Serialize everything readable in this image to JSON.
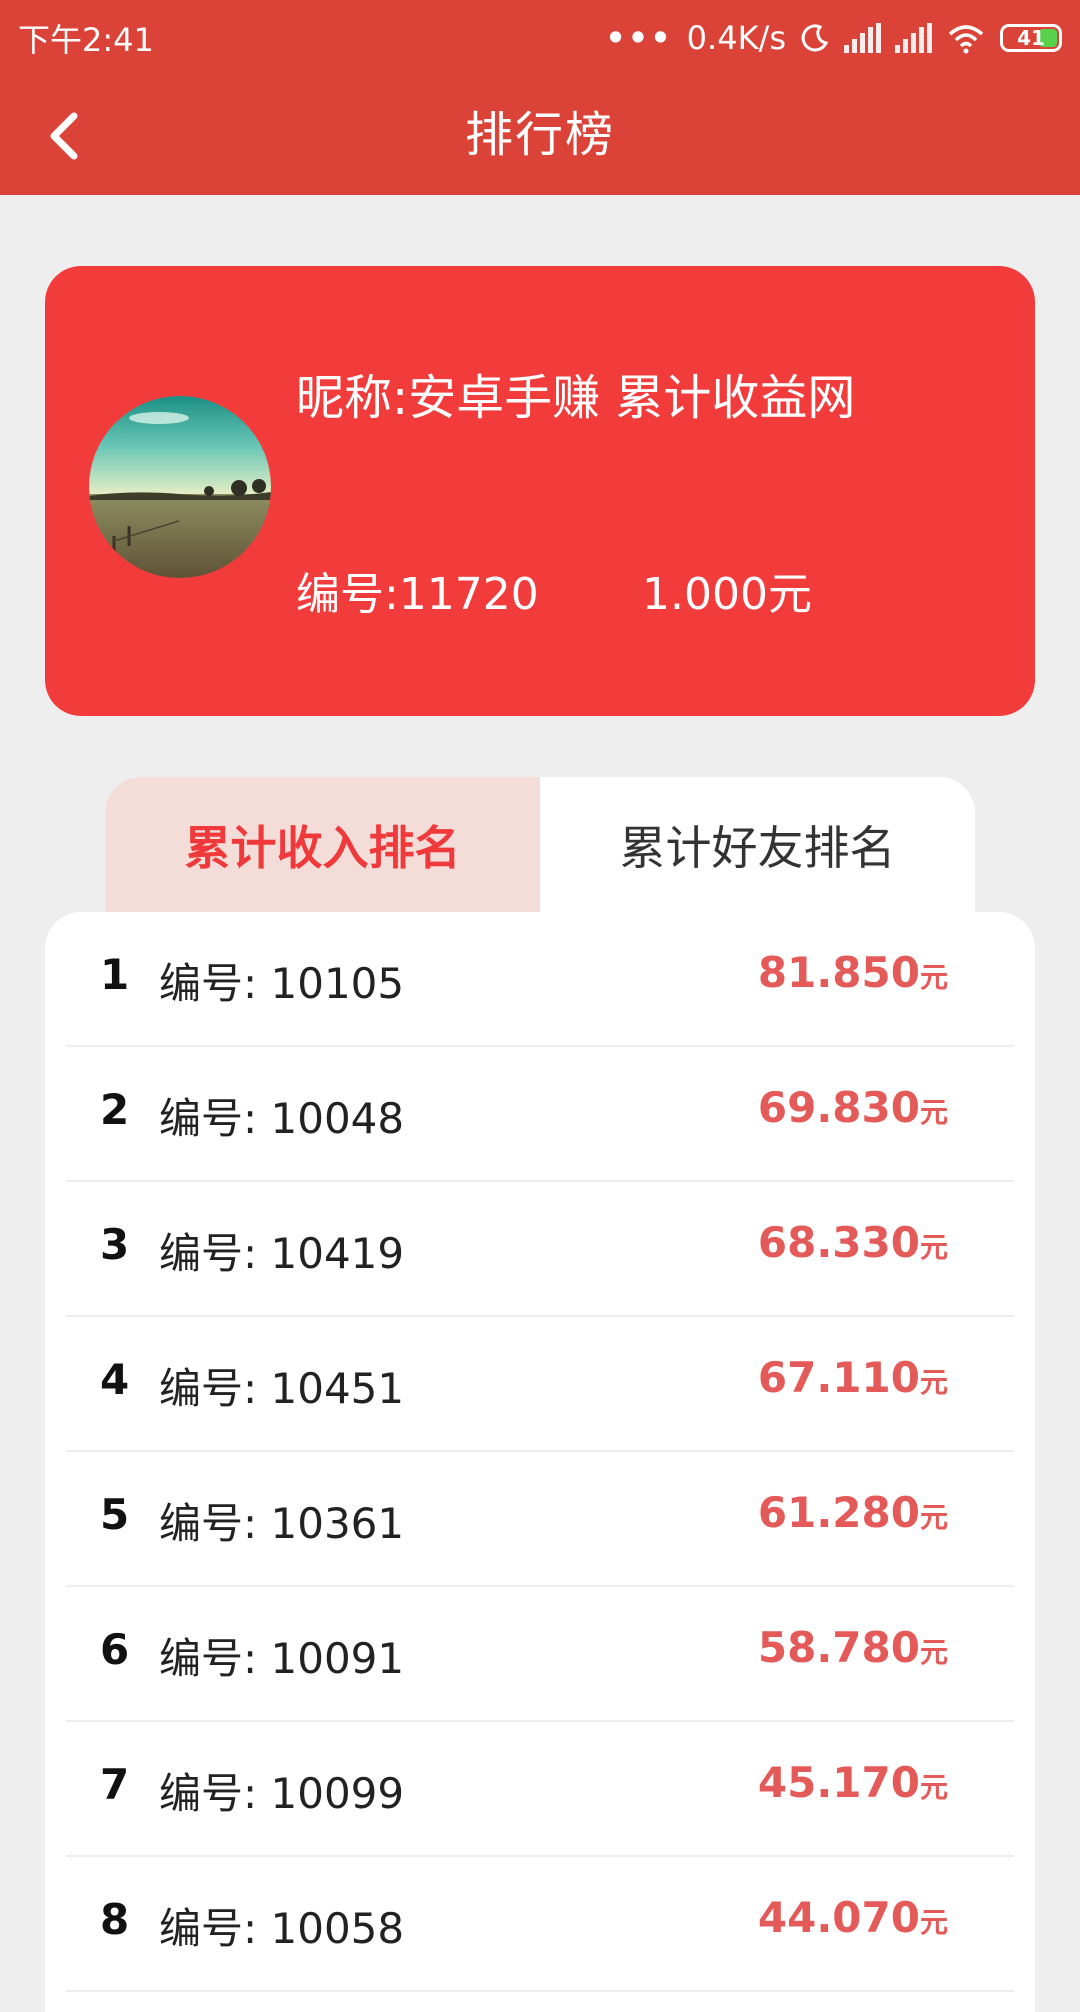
{
  "status": {
    "time": "下午2:41",
    "speed": "0.4K/s",
    "battery": "41",
    "icons": [
      "more-dots-icon",
      "moon-icon",
      "signal-icon",
      "signal-icon",
      "wifi-icon",
      "battery-icon"
    ]
  },
  "appbar": {
    "title": "排行榜",
    "back_icon": "chevron-left-icon"
  },
  "profile": {
    "nickname": "昵称:安卓手赚 累计收益网",
    "id_label": "编号:11720",
    "amount": "1.000元"
  },
  "tabs": [
    {
      "label": "累计收入排名",
      "active": true
    },
    {
      "label": "累计好友排名",
      "active": false
    }
  ],
  "ranking": [
    {
      "rank": "1",
      "id": "编号: 10105",
      "amount": "81.850",
      "unit": "元"
    },
    {
      "rank": "2",
      "id": "编号: 10048",
      "amount": "69.830",
      "unit": "元"
    },
    {
      "rank": "3",
      "id": "编号: 10419",
      "amount": "68.330",
      "unit": "元"
    },
    {
      "rank": "4",
      "id": "编号: 10451",
      "amount": "67.110",
      "unit": "元"
    },
    {
      "rank": "5",
      "id": "编号: 10361",
      "amount": "61.280",
      "unit": "元"
    },
    {
      "rank": "6",
      "id": "编号: 10091",
      "amount": "58.780",
      "unit": "元"
    },
    {
      "rank": "7",
      "id": "编号: 10099",
      "amount": "45.170",
      "unit": "元"
    },
    {
      "rank": "8",
      "id": "编号: 10058",
      "amount": "44.070",
      "unit": "元"
    }
  ],
  "colors": {
    "header": "#dc4338",
    "card": "#f23b3b",
    "accent": "#f0393b",
    "amount": "#e45a58"
  }
}
